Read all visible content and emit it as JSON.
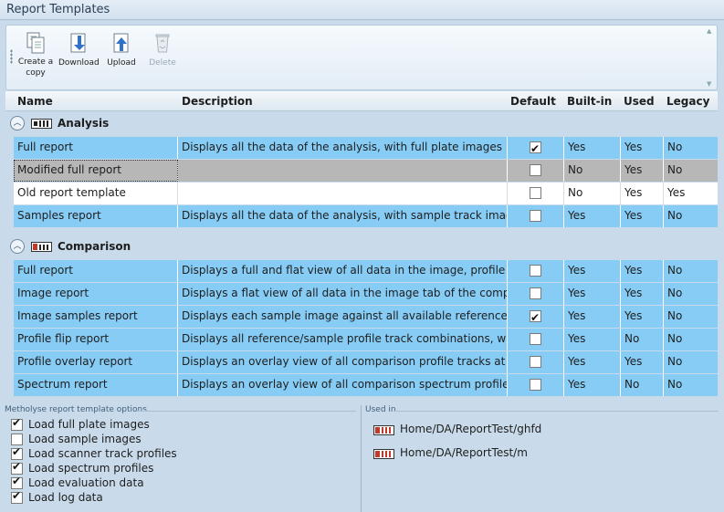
{
  "window": {
    "title": "Report Templates"
  },
  "toolbar": {
    "create_copy": {
      "line1": "Create a",
      "line2": "copy"
    },
    "download": "Download",
    "upload": "Upload",
    "delete": "Delete"
  },
  "columns": {
    "name": "Name",
    "description": "Description",
    "default": "Default",
    "builtin": "Built-in",
    "used": "Used",
    "legacy": "Legacy"
  },
  "groups": [
    {
      "name": "Analysis",
      "rows": [
        {
          "name": "Full report",
          "description": "Displays all the data of the analysis, with full plate images",
          "default": true,
          "builtin": "Yes",
          "used": "Yes",
          "legacy": "No"
        },
        {
          "name": "Modified full report",
          "description": "",
          "default": false,
          "builtin": "No",
          "used": "Yes",
          "legacy": "No"
        },
        {
          "name": "Old report template",
          "description": "",
          "default": false,
          "builtin": "No",
          "used": "Yes",
          "legacy": "Yes"
        },
        {
          "name": "Samples report",
          "description": "Displays all the data of the analysis, with sample track images",
          "default": false,
          "builtin": "Yes",
          "used": "Yes",
          "legacy": "No"
        }
      ]
    },
    {
      "name": "Comparison",
      "rows": [
        {
          "name": "Full report",
          "description": "Displays a full and flat view of all data in the image, profile and spe",
          "default": false,
          "builtin": "Yes",
          "used": "Yes",
          "legacy": "No"
        },
        {
          "name": "Image report",
          "description": "Displays a flat view of all data in the image tab of the comparison",
          "default": false,
          "builtin": "Yes",
          "used": "Yes",
          "legacy": "No"
        },
        {
          "name": "Image samples report",
          "description": "Displays each sample image against all available references, with a",
          "default": true,
          "builtin": "Yes",
          "used": "Yes",
          "legacy": "No"
        },
        {
          "name": "Profile flip report",
          "description": "Displays all reference/sample profile track combinations, with the s",
          "default": false,
          "builtin": "Yes",
          "used": "No",
          "legacy": "No"
        },
        {
          "name": "Profile overlay report",
          "description": "Displays an overlay view of all comparison profile tracks at each av",
          "default": false,
          "builtin": "Yes",
          "used": "Yes",
          "legacy": "No"
        },
        {
          "name": "Spectrum report",
          "description": "Displays an overlay view of all comparison spectrum profiles",
          "default": false,
          "builtin": "Yes",
          "used": "No",
          "legacy": "No"
        }
      ]
    }
  ],
  "options": {
    "title": "Metholyse report template options",
    "items": [
      {
        "label": "Load full plate images",
        "checked": true
      },
      {
        "label": "Load sample images",
        "checked": false
      },
      {
        "label": "Load scanner track profiles",
        "checked": true
      },
      {
        "label": "Load spectrum profiles",
        "checked": true
      },
      {
        "label": "Load evaluation data",
        "checked": true
      },
      {
        "label": "Load log data",
        "checked": true
      }
    ]
  },
  "used_in": {
    "title": "Used in",
    "items": [
      {
        "path": "Home/DA/ReportTest/ghfd"
      },
      {
        "path": "Home/DA/ReportTest/m"
      }
    ]
  },
  "colors": {
    "row_blue": "#86ccf5",
    "row_selected_gray": "#b7b7b7",
    "background": "#c9dbea"
  }
}
